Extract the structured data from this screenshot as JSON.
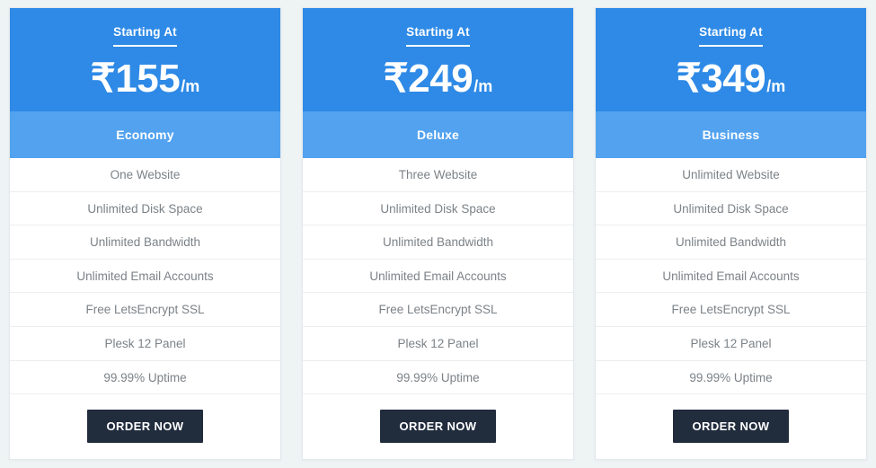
{
  "colors": {
    "page_background": "#eef3f4",
    "header_blue": "#2e8ae6",
    "plan_band_blue": "#52a2ef",
    "button_dark": "#212c3d",
    "feature_text": "#7c8287",
    "divider": "#ebeef0",
    "card_border": "#e3e8ea"
  },
  "common": {
    "starting_label": "Starting At",
    "period_suffix": "/m",
    "order_label": "ORDER NOW"
  },
  "plans": [
    {
      "name": "Economy",
      "price": "₹155",
      "period": "/m",
      "starting_label": "Starting At",
      "order_label": "ORDER NOW",
      "features": [
        "One Website",
        "Unlimited Disk Space",
        "Unlimited Bandwidth",
        "Unlimited Email Accounts",
        "Free LetsEncrypt SSL",
        "Plesk 12 Panel",
        "99.99% Uptime"
      ]
    },
    {
      "name": "Deluxe",
      "price": "₹249",
      "period": "/m",
      "starting_label": "Starting At",
      "order_label": "ORDER NOW",
      "features": [
        "Three Website",
        "Unlimited Disk Space",
        "Unlimited Bandwidth",
        "Unlimited Email Accounts",
        "Free LetsEncrypt SSL",
        "Plesk 12 Panel",
        "99.99% Uptime"
      ]
    },
    {
      "name": "Business",
      "price": "₹349",
      "period": "/m",
      "starting_label": "Starting At",
      "order_label": "ORDER NOW",
      "features": [
        "Unlimited Website",
        "Unlimited Disk Space",
        "Unlimited Bandwidth",
        "Unlimited Email Accounts",
        "Free LetsEncrypt SSL",
        "Plesk 12 Panel",
        "99.99% Uptime"
      ]
    }
  ]
}
